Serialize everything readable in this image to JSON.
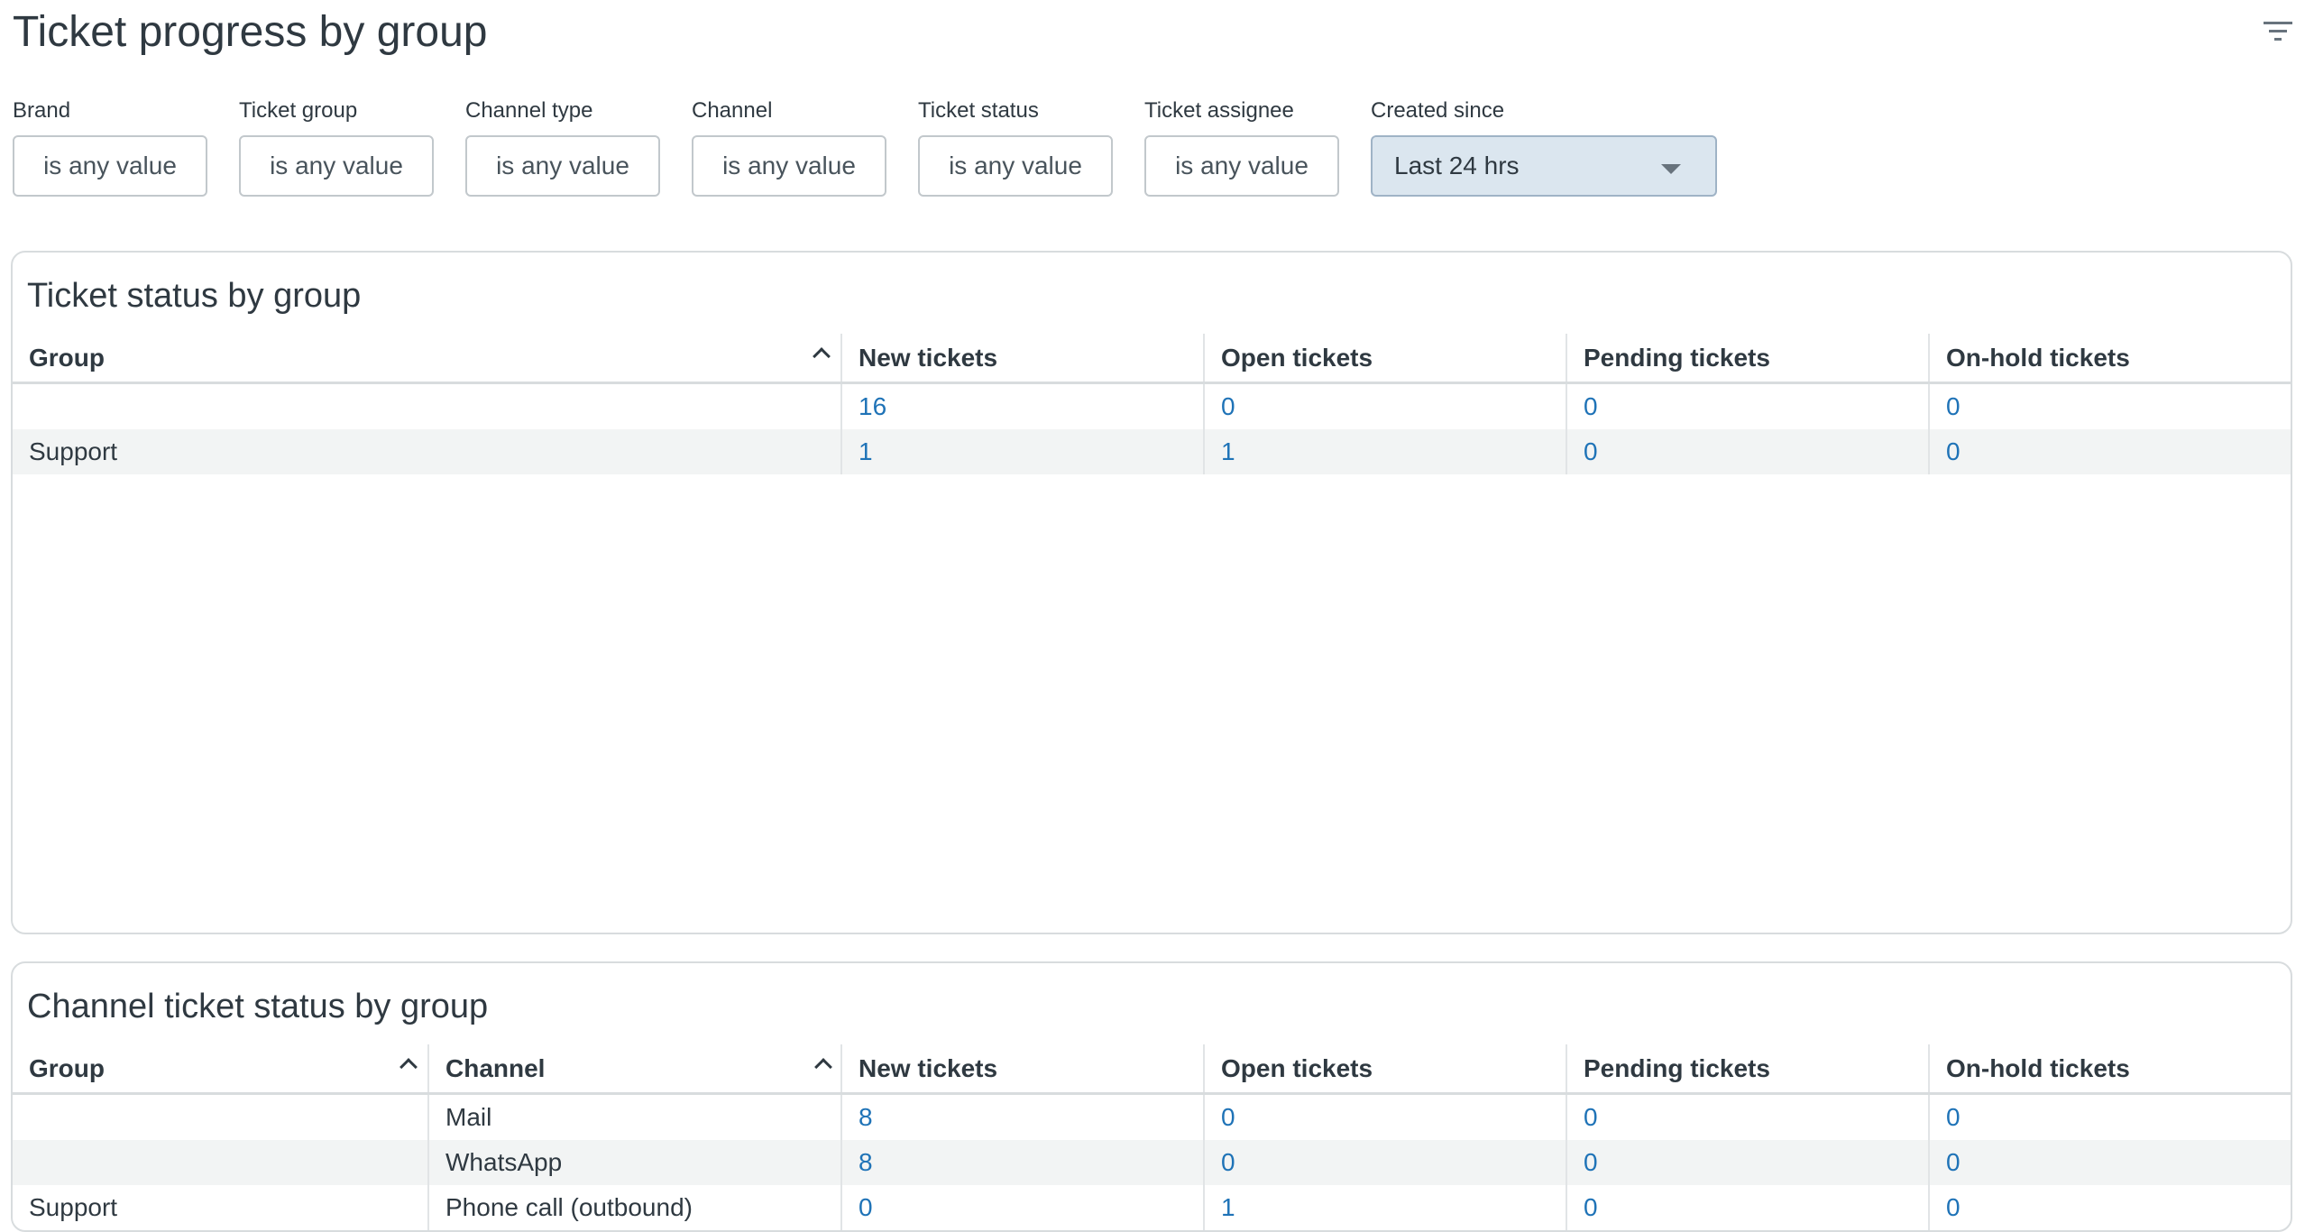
{
  "header": {
    "title": "Ticket progress by group",
    "filter_icon": "filter-lines-icon"
  },
  "filters": [
    {
      "label": "Brand",
      "value": "is any value"
    },
    {
      "label": "Ticket group",
      "value": "is any value"
    },
    {
      "label": "Channel type",
      "value": "is any value"
    },
    {
      "label": "Channel",
      "value": "is any value"
    },
    {
      "label": "Ticket status",
      "value": "is any value"
    },
    {
      "label": "Ticket assignee",
      "value": "is any value"
    },
    {
      "label": "Created since",
      "value": "Last 24 hrs"
    }
  ],
  "colors": {
    "accent_link": "#1f73b7",
    "active_filter_bg": "#dbe6ef",
    "zebra": "#f2f4f4"
  },
  "table1": {
    "title": "Ticket status by group",
    "columns": [
      "Group",
      "New tickets",
      "Open tickets",
      "Pending tickets",
      "On-hold tickets"
    ],
    "rows": [
      [
        "",
        "16",
        "0",
        "0",
        "0"
      ],
      [
        "Support",
        "1",
        "1",
        "0",
        "0"
      ]
    ]
  },
  "table2": {
    "title": "Channel ticket status by group",
    "columns": [
      "Group",
      "Channel",
      "New tickets",
      "Open tickets",
      "Pending tickets",
      "On-hold tickets"
    ],
    "rows": [
      [
        "",
        "Mail",
        "8",
        "0",
        "0",
        "0"
      ],
      [
        "",
        "WhatsApp",
        "8",
        "0",
        "0",
        "0"
      ],
      [
        "Support",
        "Phone call (outbound)",
        "0",
        "1",
        "0",
        "0"
      ]
    ]
  }
}
